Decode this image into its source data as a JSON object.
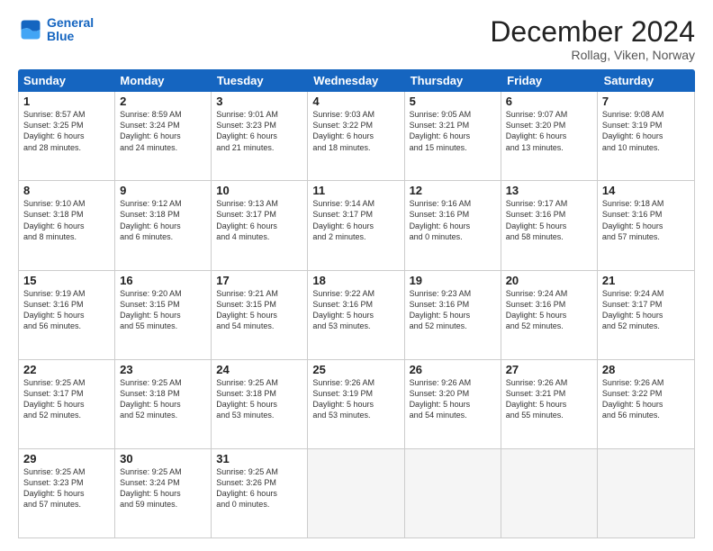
{
  "logo": {
    "line1": "General",
    "line2": "Blue"
  },
  "title": "December 2024",
  "subtitle": "Rollag, Viken, Norway",
  "days": [
    "Sunday",
    "Monday",
    "Tuesday",
    "Wednesday",
    "Thursday",
    "Friday",
    "Saturday"
  ],
  "weeks": [
    [
      {
        "day": "1",
        "sunrise": "8:57 AM",
        "sunset": "3:25 PM",
        "daylight": "6 hours and 28 minutes."
      },
      {
        "day": "2",
        "sunrise": "8:59 AM",
        "sunset": "3:24 PM",
        "daylight": "6 hours and 24 minutes."
      },
      {
        "day": "3",
        "sunrise": "9:01 AM",
        "sunset": "3:23 PM",
        "daylight": "6 hours and 21 minutes."
      },
      {
        "day": "4",
        "sunrise": "9:03 AM",
        "sunset": "3:22 PM",
        "daylight": "6 hours and 18 minutes."
      },
      {
        "day": "5",
        "sunrise": "9:05 AM",
        "sunset": "3:21 PM",
        "daylight": "6 hours and 15 minutes."
      },
      {
        "day": "6",
        "sunrise": "9:07 AM",
        "sunset": "3:20 PM",
        "daylight": "6 hours and 13 minutes."
      },
      {
        "day": "7",
        "sunrise": "9:08 AM",
        "sunset": "3:19 PM",
        "daylight": "6 hours and 10 minutes."
      }
    ],
    [
      {
        "day": "8",
        "sunrise": "9:10 AM",
        "sunset": "3:18 PM",
        "daylight": "6 hours and 8 minutes."
      },
      {
        "day": "9",
        "sunrise": "9:12 AM",
        "sunset": "3:18 PM",
        "daylight": "6 hours and 6 minutes."
      },
      {
        "day": "10",
        "sunrise": "9:13 AM",
        "sunset": "3:17 PM",
        "daylight": "6 hours and 4 minutes."
      },
      {
        "day": "11",
        "sunrise": "9:14 AM",
        "sunset": "3:17 PM",
        "daylight": "6 hours and 2 minutes."
      },
      {
        "day": "12",
        "sunrise": "9:16 AM",
        "sunset": "3:16 PM",
        "daylight": "6 hours and 0 minutes."
      },
      {
        "day": "13",
        "sunrise": "9:17 AM",
        "sunset": "3:16 PM",
        "daylight": "5 hours and 58 minutes."
      },
      {
        "day": "14",
        "sunrise": "9:18 AM",
        "sunset": "3:16 PM",
        "daylight": "5 hours and 57 minutes."
      }
    ],
    [
      {
        "day": "15",
        "sunrise": "9:19 AM",
        "sunset": "3:16 PM",
        "daylight": "5 hours and 56 minutes."
      },
      {
        "day": "16",
        "sunrise": "9:20 AM",
        "sunset": "3:15 PM",
        "daylight": "5 hours and 55 minutes."
      },
      {
        "day": "17",
        "sunrise": "9:21 AM",
        "sunset": "3:15 PM",
        "daylight": "5 hours and 54 minutes."
      },
      {
        "day": "18",
        "sunrise": "9:22 AM",
        "sunset": "3:16 PM",
        "daylight": "5 hours and 53 minutes."
      },
      {
        "day": "19",
        "sunrise": "9:23 AM",
        "sunset": "3:16 PM",
        "daylight": "5 hours and 52 minutes."
      },
      {
        "day": "20",
        "sunrise": "9:24 AM",
        "sunset": "3:16 PM",
        "daylight": "5 hours and 52 minutes."
      },
      {
        "day": "21",
        "sunrise": "9:24 AM",
        "sunset": "3:17 PM",
        "daylight": "5 hours and 52 minutes."
      }
    ],
    [
      {
        "day": "22",
        "sunrise": "9:25 AM",
        "sunset": "3:17 PM",
        "daylight": "5 hours and 52 minutes."
      },
      {
        "day": "23",
        "sunrise": "9:25 AM",
        "sunset": "3:18 PM",
        "daylight": "5 hours and 52 minutes."
      },
      {
        "day": "24",
        "sunrise": "9:25 AM",
        "sunset": "3:18 PM",
        "daylight": "5 hours and 53 minutes."
      },
      {
        "day": "25",
        "sunrise": "9:26 AM",
        "sunset": "3:19 PM",
        "daylight": "5 hours and 53 minutes."
      },
      {
        "day": "26",
        "sunrise": "9:26 AM",
        "sunset": "3:20 PM",
        "daylight": "5 hours and 54 minutes."
      },
      {
        "day": "27",
        "sunrise": "9:26 AM",
        "sunset": "3:21 PM",
        "daylight": "5 hours and 55 minutes."
      },
      {
        "day": "28",
        "sunrise": "9:26 AM",
        "sunset": "3:22 PM",
        "daylight": "5 hours and 56 minutes."
      }
    ],
    [
      {
        "day": "29",
        "sunrise": "9:25 AM",
        "sunset": "3:23 PM",
        "daylight": "5 hours and 57 minutes."
      },
      {
        "day": "30",
        "sunrise": "9:25 AM",
        "sunset": "3:24 PM",
        "daylight": "5 hours and 59 minutes."
      },
      {
        "day": "31",
        "sunrise": "9:25 AM",
        "sunset": "3:26 PM",
        "daylight": "6 hours and 0 minutes."
      },
      null,
      null,
      null,
      null
    ]
  ]
}
